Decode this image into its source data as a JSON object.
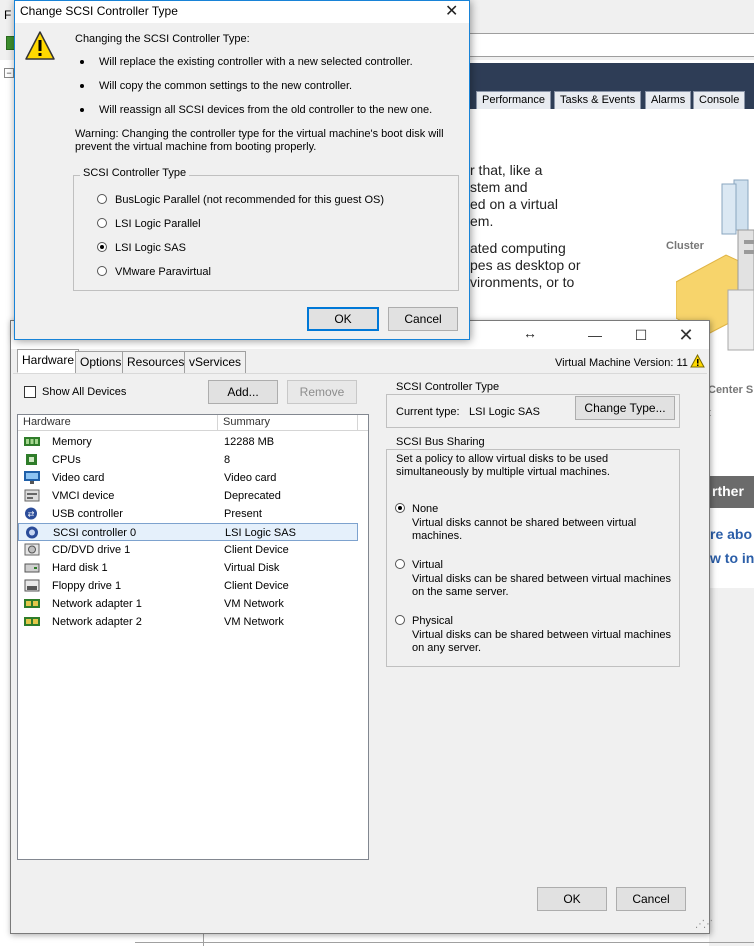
{
  "background_app": {
    "menu_letter": "F",
    "tabs": [
      "Performance",
      "Tasks & Events",
      "Alarms",
      "Console"
    ],
    "partial_text_lines": [
      "r that, like a",
      "stem and",
      "ed on a virtual",
      "em.",
      "ated computing",
      "pes as desktop or",
      "vironments, or to"
    ],
    "cluster_label": "Cluster",
    "center_label": "Center S",
    "letter_t": "t",
    "section_header": "rther",
    "links": [
      "re abo",
      "w to in"
    ]
  },
  "vm_dialog": {
    "tabs": [
      "Hardware",
      "Options",
      "Resources",
      "vServices"
    ],
    "version_label": "Virtual Machine Version: 11",
    "show_all_devices": "Show All Devices",
    "add_button": "Add...",
    "remove_button": "Remove",
    "columns": [
      "Hardware",
      "Summary"
    ],
    "hardware": [
      {
        "icon": "memory-icon",
        "name": "Memory",
        "summary": "12288 MB"
      },
      {
        "icon": "cpu-icon",
        "name": "CPUs",
        "summary": "8"
      },
      {
        "icon": "monitor-icon",
        "name": "Video card",
        "summary": "Video card"
      },
      {
        "icon": "vmci-icon",
        "name": "VMCI device",
        "summary": "Deprecated"
      },
      {
        "icon": "usb-icon",
        "name": "USB controller",
        "summary": "Present"
      },
      {
        "icon": "scsi-icon",
        "name": "SCSI controller 0",
        "summary": "LSI Logic SAS"
      },
      {
        "icon": "cd-drive-icon",
        "name": "CD/DVD drive 1",
        "summary": "Client Device"
      },
      {
        "icon": "hard-disk-icon",
        "name": "Hard disk 1",
        "summary": "Virtual Disk"
      },
      {
        "icon": "floppy-icon",
        "name": "Floppy drive 1",
        "summary": "Client Device"
      },
      {
        "icon": "network-adapter-icon",
        "name": "Network adapter 1",
        "summary": "VM Network"
      },
      {
        "icon": "network-adapter-icon",
        "name": "Network adapter 2",
        "summary": "VM Network"
      }
    ],
    "selected_index": 5,
    "controller_group": {
      "title": "SCSI Controller Type",
      "current_type_label": "Current type:",
      "current_type_value": "LSI Logic SAS",
      "change_button": "Change Type..."
    },
    "bus_sharing": {
      "title": "SCSI Bus Sharing",
      "description_line1": "Set a policy to allow virtual disks to be used",
      "description_line2": "simultaneously by multiple virtual machines.",
      "options": [
        {
          "label": "None",
          "desc1": "Virtual disks cannot be shared between virtual",
          "desc2": "machines.",
          "checked": true
        },
        {
          "label": "Virtual",
          "desc1": "Virtual disks can be shared between virtual machines",
          "desc2": "on the same server.",
          "checked": false
        },
        {
          "label": "Physical",
          "desc1": "Virtual disks can be shared between virtual machines",
          "desc2": "on any server.",
          "checked": false
        }
      ]
    },
    "ok_button": "OK",
    "cancel_button": "Cancel"
  },
  "scsi_dialog": {
    "title": "Change SCSI Controller Type",
    "intro": "Changing the SCSI Controller Type:",
    "bullets": [
      "Will replace the existing controller with a new selected controller.",
      "Will copy the common settings to the new controller.",
      "Will reassign all SCSI devices from the old controller to the new one."
    ],
    "warning_line1": "Warning: Changing the controller type for the virtual machine's boot disk will",
    "warning_line2": "prevent the virtual machine from booting properly.",
    "group_title": "SCSI Controller Type",
    "options": [
      {
        "label": "BusLogic Parallel (not recommended for this guest OS)",
        "checked": false
      },
      {
        "label": "LSI Logic Parallel",
        "checked": false
      },
      {
        "label": "LSI Logic SAS",
        "checked": true
      },
      {
        "label": "VMware Paravirtual",
        "checked": false
      }
    ],
    "ok_button": "OK",
    "cancel_button": "Cancel"
  },
  "colors": {
    "accent_blue": "#0078d7",
    "navy_header": "#2e3d56",
    "warning_yellow": "#ffd800"
  }
}
